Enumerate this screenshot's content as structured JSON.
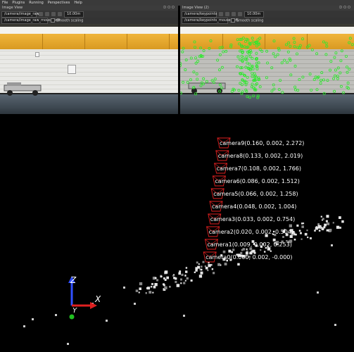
{
  "menubar": {
    "items": [
      "File",
      "Plugins",
      "Running",
      "Perspectives",
      "Help"
    ]
  },
  "left_panel": {
    "title": "Image View",
    "topic_select": "/camera/image_raw",
    "topic_path": "/camera/image_raw_mouse_left",
    "smooth_label": "Smooth scaling",
    "zoom_value": "10.00m"
  },
  "right_panel": {
    "title": "Image View (2)",
    "topic_select": "/camera/keypoints",
    "topic_path": "/camera/keypoints_mouse_left",
    "smooth_label": "Smooth scaling",
    "zoom_value": "10.00m"
  },
  "window_buttons": "DOO",
  "scene": {
    "axes": {
      "x_label": "X",
      "y_label": "Y",
      "z_label": "Z"
    },
    "colors": {
      "camera_frame": "#e02020",
      "label": "#ffffff",
      "points": "#dddddd",
      "x_axis": "#e02020",
      "y_axis": "#20c020",
      "z_axis": "#3050ff"
    },
    "cameras": [
      {
        "label": "camera9(0.160, 0.002, 2.272)"
      },
      {
        "label": "camera8(0.133, 0.002, 2.019)"
      },
      {
        "label": "camera7(0.108, 0.002, 1.766)"
      },
      {
        "label": "camera6(0.086, 0.002, 1.512)"
      },
      {
        "label": "camera5(0.066, 0.002, 1.258)"
      },
      {
        "label": "camera4(0.048, 0.002, 1.004)"
      },
      {
        "label": "camera3(0.033, 0.002, 0.754)"
      },
      {
        "label": "camera2(0.020, 0.002, 0.504)"
      },
      {
        "label": "camera1(0.009, 0.002, 0.253)"
      },
      {
        "label": "camera0(0.000, 0.002, -0.000)"
      }
    ]
  }
}
